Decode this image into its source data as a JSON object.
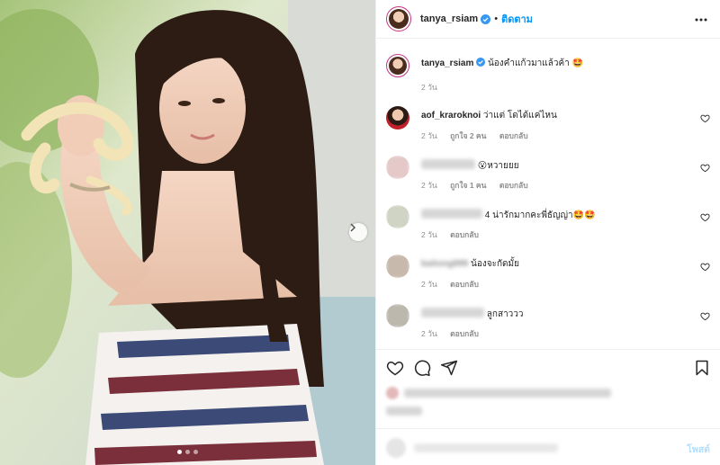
{
  "post": {
    "author": "tanya_rsiam",
    "follow_label": "ติดตาม",
    "separator": "•",
    "caption_text": "น้องคำแก้วมาแล้วค้า 🤩",
    "caption_time": "2 วัน",
    "carousel": {
      "slides": 3,
      "active": 1
    }
  },
  "comments": [
    {
      "user": "aof_kraroknoi",
      "text": "ว่าแต่ โดได้แค่ไหน",
      "time": "2 วัน",
      "likes": "ถูกใจ 2 คน",
      "reply": "ตอบกลับ",
      "user_blurred": false
    },
    {
      "user": "",
      "text": "😮หวายยย",
      "time": "2 วัน",
      "likes": "ถูกใจ 1 คน",
      "reply": "ตอบกลับ",
      "user_blurred": true
    },
    {
      "user": "",
      "text": "4 น่ารักมากคะพี่ธัญญ่า🤩🤩",
      "time": "2 วัน",
      "likes": "",
      "reply": "ตอบกลับ",
      "user_blurred": true
    },
    {
      "user": "kaitong999",
      "text": "น้องจะกัดมั้ย",
      "time": "2 วัน",
      "likes": "",
      "reply": "ตอบกลับ",
      "user_blurred": true
    },
    {
      "user": "",
      "text": "ลูกสาววว",
      "time": "2 วัน",
      "likes": "",
      "reply": "ตอบกลับ",
      "user_blurred": true
    }
  ],
  "add_comment": {
    "post_label": "โพสต์"
  },
  "icons": {
    "verified": "verified-badge-icon",
    "more": "more-options-icon",
    "like": "heart-icon",
    "comment": "comment-icon",
    "share": "share-icon",
    "save": "bookmark-icon",
    "next": "chevron-right-icon"
  },
  "colors": {
    "accent": "#0095f6",
    "verified": "#3897f0",
    "muted": "#8e8e8e"
  }
}
